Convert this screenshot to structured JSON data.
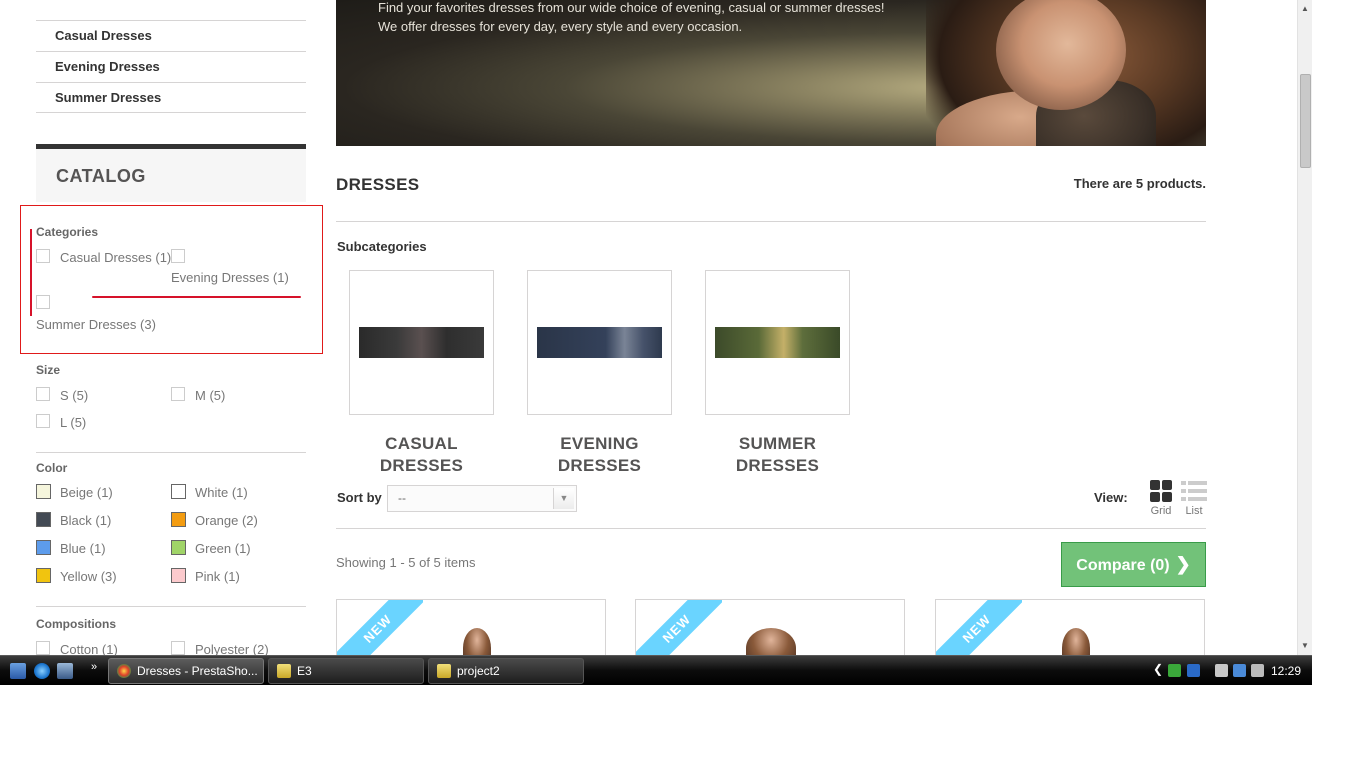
{
  "sidebar": {
    "top_categories": [
      "Casual Dresses",
      "Evening Dresses",
      "Summer Dresses"
    ],
    "catalog_title": "CATALOG",
    "filters": {
      "categories_title": "Categories",
      "categories": [
        "Casual Dresses (1)",
        "Evening Dresses (1)",
        "Summer Dresses (3)"
      ],
      "size_title": "Size",
      "sizes": [
        "S (5)",
        "M (5)",
        "L (5)"
      ],
      "color_title": "Color",
      "colors": [
        {
          "label": "Beige (1)",
          "hex": "#f5f5dc"
        },
        {
          "label": "White (1)",
          "hex": "#ffffff"
        },
        {
          "label": "Black (1)",
          "hex": "#434a54"
        },
        {
          "label": "Orange (2)",
          "hex": "#f39c11"
        },
        {
          "label": "Blue (1)",
          "hex": "#5d9cec"
        },
        {
          "label": "Green (1)",
          "hex": "#a0d468"
        },
        {
          "label": "Yellow (3)",
          "hex": "#f1c40f"
        },
        {
          "label": "Pink (1)",
          "hex": "#fccacd"
        }
      ],
      "compositions_title": "Compositions",
      "compositions": [
        "Cotton (1)",
        "Polyester (2)"
      ]
    }
  },
  "banner": {
    "line1": "Find your favorites dresses from our wide choice of evening, casual or summer dresses!",
    "line2": "We offer dresses for every day, every style and every occasion."
  },
  "main": {
    "heading": "DRESSES",
    "count_prefix": "There are ",
    "count_number": "5",
    "count_suffix": " products.",
    "subcategories_title": "Subcategories",
    "subcategories": [
      {
        "line1": "CASUAL",
        "line2": "DRESSES"
      },
      {
        "line1": "EVENING",
        "line2": "DRESSES"
      },
      {
        "line1": "SUMMER",
        "line2": "DRESSES"
      }
    ],
    "sort_label": "Sort by",
    "sort_value": "--",
    "view_label": "View:",
    "view_grid": "Grid",
    "view_list": "List",
    "showing": "Showing 1 - 5 of 5 items",
    "compare_label": "Compare (0)",
    "new_badge": "NEW"
  },
  "taskbar": {
    "tasks": [
      "Dresses - PrestaSho...",
      "E3",
      "project2"
    ],
    "clock": "12:29"
  },
  "colors": {
    "accent_green": "#72c279",
    "ribbon_blue": "#6ad4ff",
    "annotation_red": "#e01a1a"
  }
}
